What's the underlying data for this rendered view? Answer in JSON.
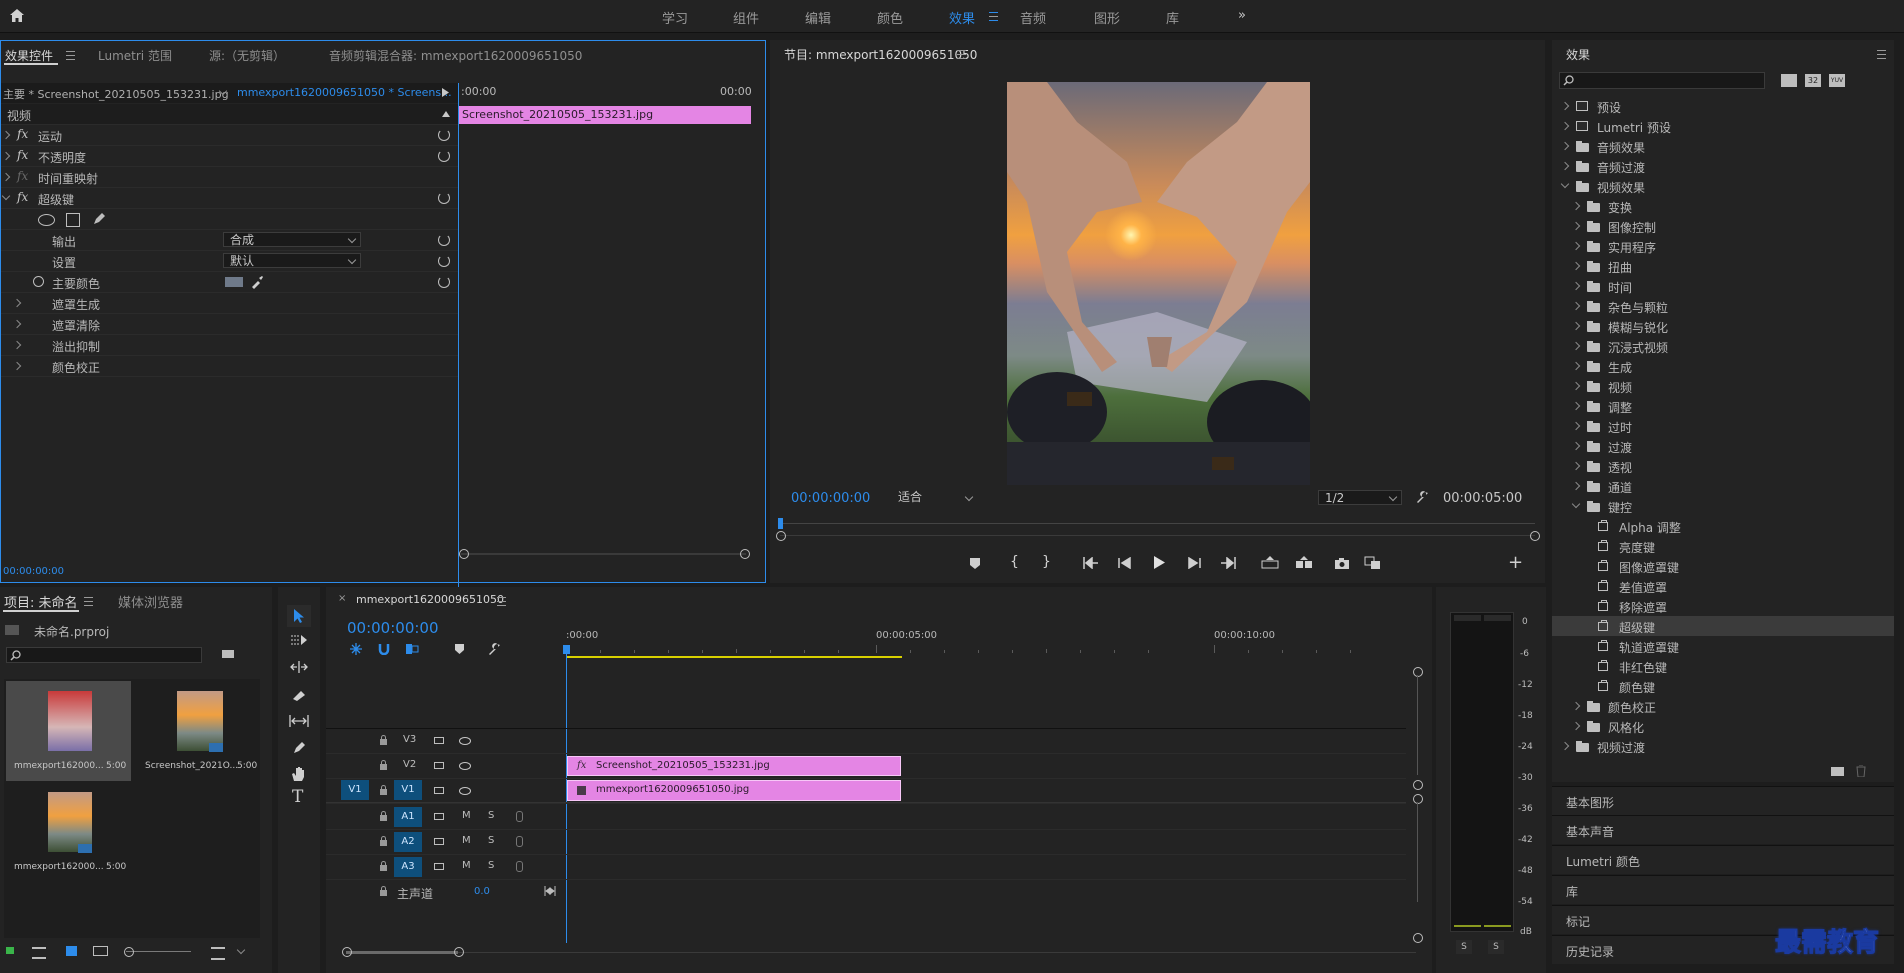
{
  "top_nav": {
    "items": [
      "学习",
      "组件",
      "编辑",
      "颜色",
      "效果",
      "音频",
      "图形",
      "库"
    ],
    "active": "效果",
    "more": "»"
  },
  "effect_controls": {
    "tabs": [
      "效果控件",
      "Lumetri 范围",
      "源:（无剪辑）",
      "音频剪辑混合器: mmexport1620009651050"
    ],
    "master_label": "主要 * Screenshot_20210505_153231.jpg",
    "sequence_label": "mmexport1620009651050 * Screens...",
    "section": "视频",
    "effects": [
      {
        "fx": "fx",
        "name": "运动"
      },
      {
        "fx": "fx",
        "name": "不透明度"
      },
      {
        "fx": "fx",
        "name": "时间重映射"
      },
      {
        "fx": "fx",
        "name": "超级键"
      }
    ],
    "output_label": "输出",
    "output_value": "合成",
    "setting_label": "设置",
    "setting_value": "默认",
    "key_color_label": "主要颜色",
    "subgroups": [
      "遮罩生成",
      "遮罩清除",
      "溢出抑制",
      "颜色校正"
    ],
    "mini_timeline": {
      "start": ":00:00",
      "end": "00:00",
      "clip": "Screenshot_20210505_153231.jpg"
    },
    "timecode": "00:00:00:00"
  },
  "program_monitor": {
    "title": "节目: mmexport1620009651050",
    "timecode": "00:00:00:00",
    "fit": "适合",
    "resolution": "1/2",
    "duration": "00:00:05:00"
  },
  "effects_panel": {
    "title": "效果",
    "search_placeholder": "",
    "badges": [
      "32",
      "YUV"
    ],
    "tree": [
      {
        "level": 0,
        "type": "preset",
        "label": "预设",
        "open": false
      },
      {
        "level": 0,
        "type": "preset",
        "label": "Lumetri 预设",
        "open": false
      },
      {
        "level": 0,
        "type": "folder",
        "label": "音频效果",
        "open": false
      },
      {
        "level": 0,
        "type": "folder",
        "label": "音频过渡",
        "open": false
      },
      {
        "level": 0,
        "type": "folder",
        "label": "视频效果",
        "open": true
      },
      {
        "level": 1,
        "type": "folder",
        "label": "变换",
        "open": false
      },
      {
        "level": 1,
        "type": "folder",
        "label": "图像控制",
        "open": false
      },
      {
        "level": 1,
        "type": "folder",
        "label": "实用程序",
        "open": false
      },
      {
        "level": 1,
        "type": "folder",
        "label": "扭曲",
        "open": false
      },
      {
        "level": 1,
        "type": "folder",
        "label": "时间",
        "open": false
      },
      {
        "level": 1,
        "type": "folder",
        "label": "杂色与颗粒",
        "open": false
      },
      {
        "level": 1,
        "type": "folder",
        "label": "模糊与锐化",
        "open": false
      },
      {
        "level": 1,
        "type": "folder",
        "label": "沉浸式视频",
        "open": false
      },
      {
        "level": 1,
        "type": "folder",
        "label": "生成",
        "open": false
      },
      {
        "level": 1,
        "type": "folder",
        "label": "视频",
        "open": false
      },
      {
        "level": 1,
        "type": "folder",
        "label": "调整",
        "open": false
      },
      {
        "level": 1,
        "type": "folder",
        "label": "过时",
        "open": false
      },
      {
        "level": 1,
        "type": "folder",
        "label": "过渡",
        "open": false
      },
      {
        "level": 1,
        "type": "folder",
        "label": "透视",
        "open": false
      },
      {
        "level": 1,
        "type": "folder",
        "label": "通道",
        "open": false
      },
      {
        "level": 1,
        "type": "folder",
        "label": "键控",
        "open": true
      },
      {
        "level": 2,
        "type": "effect",
        "label": "Alpha 调整"
      },
      {
        "level": 2,
        "type": "effect",
        "label": "亮度键"
      },
      {
        "level": 2,
        "type": "effect",
        "label": "图像遮罩键"
      },
      {
        "level": 2,
        "type": "effect",
        "label": "差值遮罩"
      },
      {
        "level": 2,
        "type": "effect",
        "label": "移除遮罩"
      },
      {
        "level": 2,
        "type": "effect",
        "label": "超级键",
        "selected": true
      },
      {
        "level": 2,
        "type": "effect",
        "label": "轨道遮罩键"
      },
      {
        "level": 2,
        "type": "effect",
        "label": "非红色键"
      },
      {
        "level": 2,
        "type": "effect",
        "label": "颜色键"
      },
      {
        "level": 1,
        "type": "folder",
        "label": "颜色校正",
        "open": false
      },
      {
        "level": 1,
        "type": "folder",
        "label": "风格化",
        "open": false
      },
      {
        "level": 0,
        "type": "folder",
        "label": "视频过渡",
        "open": false
      }
    ],
    "collapsed_panels": [
      "基本图形",
      "基本声音",
      "Lumetri 颜色",
      "库",
      "标记",
      "历史记录"
    ]
  },
  "project_panel": {
    "tabs": [
      "项目: 未命名",
      "媒体浏览器"
    ],
    "project_file": "未命名.prproj",
    "items": [
      {
        "name": "mmexport162000...",
        "duration": "5:00"
      },
      {
        "name": "Screenshot_2021O...",
        "duration": "5:00"
      },
      {
        "name": "mmexport162000...",
        "duration": "5:00"
      }
    ]
  },
  "timeline": {
    "tab": "mmexport1620009651050",
    "timecode": "00:00:00:00",
    "ruler": [
      ":00:00",
      "00:00:05:00",
      "00:00:10:00"
    ],
    "video_tracks": [
      "V3",
      "V2",
      "V1"
    ],
    "audio_tracks": [
      "A1",
      "A2",
      "A3"
    ],
    "source_patch": "V1",
    "mute": "M",
    "solo": "S",
    "master": "主声道",
    "master_value": "0.0",
    "clips": [
      {
        "track": "V2",
        "name": "Screenshot_20210505_153231.jpg",
        "badge": "fx"
      },
      {
        "track": "V1",
        "name": "mmexport1620009651050.jpg"
      }
    ]
  },
  "audio_meter": {
    "scale": [
      "0",
      "-6",
      "-12",
      "-18",
      "-24",
      "-30",
      "-36",
      "-42",
      "-48",
      "-54",
      "dB"
    ],
    "solo_buttons": [
      "S",
      "S"
    ]
  },
  "watermark": "最需教育"
}
